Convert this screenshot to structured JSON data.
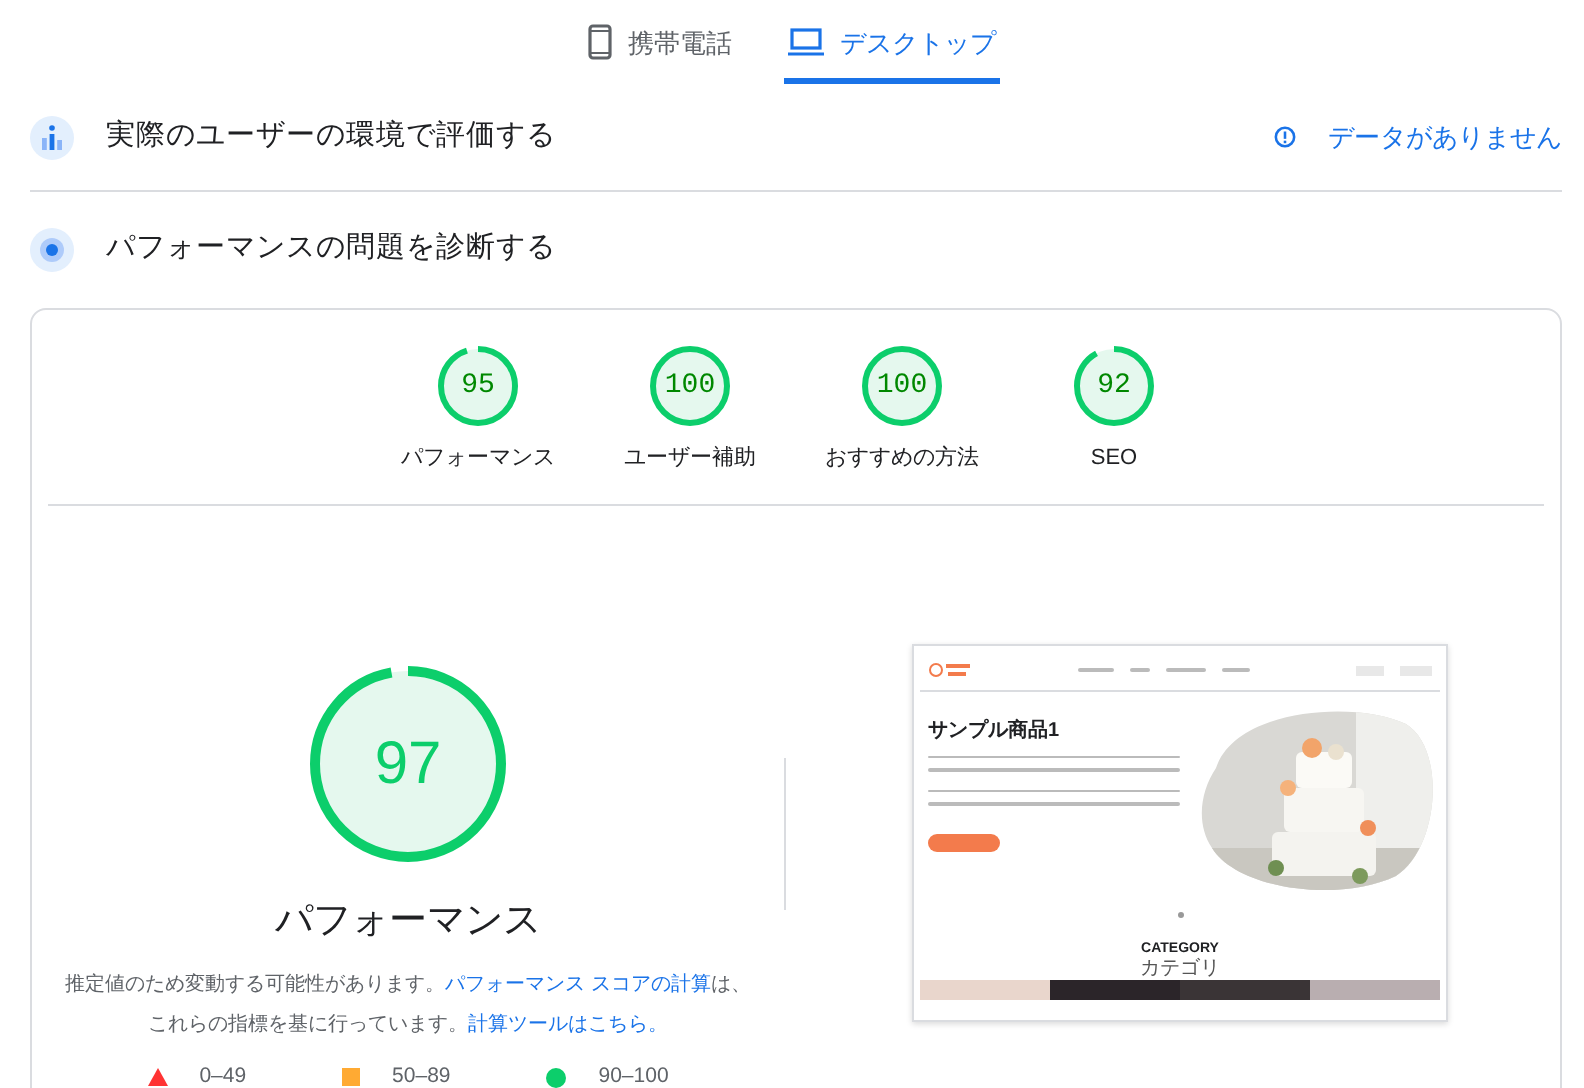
{
  "tabs": [
    {
      "label": "携帯電話",
      "selected": false
    },
    {
      "label": "デスクトップ",
      "selected": true
    }
  ],
  "field_section": {
    "title": "実際のユーザーの環境で評価する",
    "status": "データがありません"
  },
  "lab_section": {
    "title": "パフォーマンスの問題を診断する",
    "categories": [
      {
        "score": "95",
        "level": 0.95,
        "label": "パフォーマンス"
      },
      {
        "score": "100",
        "level": 1,
        "label": "ユーザー補助"
      },
      {
        "score": "100",
        "level": 1,
        "label": "おすすめの方法"
      },
      {
        "score": "92",
        "level": 0.92,
        "label": "SEO"
      }
    ],
    "main": {
      "score": "97",
      "level": 0.97,
      "title": "パフォーマンス",
      "description": [
        {
          "text": "推定値のため変動する可能性があります。",
          "link": false
        },
        {
          "text": "パフォーマンス スコアの計算",
          "link": true
        },
        {
          "text": "は、これらの指標を基に行っています。",
          "link": false
        },
        {
          "text": "計算ツールはこちら。",
          "link": true
        }
      ]
    },
    "legend": [
      {
        "kind": "triangle",
        "color": "#ff3333",
        "range": "0–49"
      },
      {
        "kind": "square",
        "color": "#ffaa33",
        "range": "50–89"
      },
      {
        "kind": "circle",
        "color": "#0cce6b",
        "range": "90–100"
      }
    ],
    "screenshot": {
      "heading": "サンプル商品1",
      "section_title": "CATEGORY",
      "section_subtitle": "カテゴリ"
    }
  }
}
